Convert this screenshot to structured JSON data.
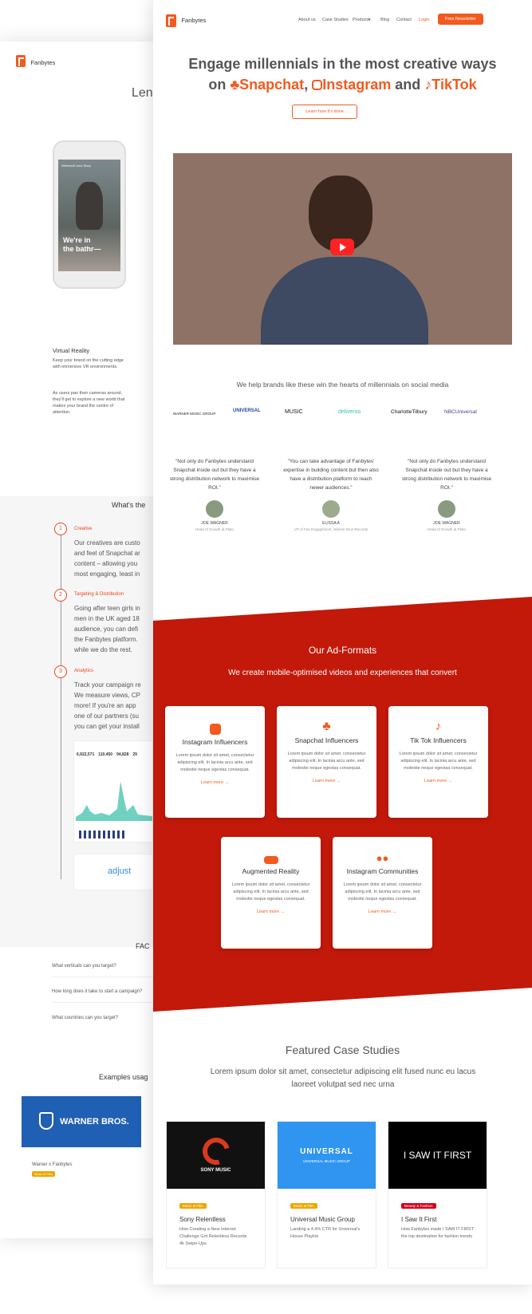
{
  "brand": "Fanbytes",
  "back": {
    "hero_partial": "Lens",
    "phone_overlay_title": "Werewolf Lens Story",
    "phone_caption_line1": "We're in",
    "phone_caption_line2": "the bathr—",
    "vr_title": "Virtual Reality",
    "vr_text1": "Keep your brand on the cutting edge with immersive VR environments.",
    "vr_text2": "As users pan their cameras around, they'll get to explore a new world that makes your brand the centre of attention.",
    "whats_partial": "What's the",
    "steps": [
      {
        "num": "1",
        "title": "Creative",
        "text": "Our creatives are custo and feel of Snapchat ar content – allowing you most engaging, least in"
      },
      {
        "num": "2",
        "title": "Targeting & Distribution",
        "text": "Going after teen girls in men in the UK aged 18 audience, you can defi the Fanbytes platform. while we do the rest."
      },
      {
        "num": "3",
        "title": "Analytics",
        "text": "Track your campaign re We measure views, CP more! If you're an app one of our partners (su you can get your install"
      }
    ],
    "stats": [
      "6,922,571",
      "110,450",
      "94,828",
      "29"
    ],
    "adjust": "adjust",
    "faq_partial": "FAC",
    "faqs": [
      "What verticals can you target?",
      "How long does it take to start a campaign?",
      "What countries can you target?"
    ],
    "examples_partial": "Examples usag",
    "wb_label": "WARNER BROS.",
    "wb_caption": "Warner x Fanbytes",
    "wb_tag": "Music & Film"
  },
  "nav": {
    "items": [
      "About us",
      "Case Studies",
      "Products",
      "Blog",
      "Contact"
    ],
    "login": "Login",
    "cta": "Free Newsletter"
  },
  "hero": {
    "line1": "Engage millennials in the most creative ways",
    "on": "on",
    "snapchat": "Snapchat",
    "comma": ",",
    "instagram": "Instagram",
    "and": "and",
    "tiktok": "TikTok",
    "button": "Learn how it's done"
  },
  "brands": {
    "heading": "We help brands like these win the hearts of millennials on social media",
    "logos": [
      "WARNER MUSIC GROUP",
      "UNIVERSAL",
      "MUSIC",
      "deliveroo",
      "CharlotteTilbury",
      "NBCUniversal"
    ]
  },
  "testimonials": [
    {
      "quote": "\"Not only do Fanbytes understand Snapchat inside out but they have a strong distribution network to maximise ROI.\"",
      "name": "JOE WAGNER",
      "role": "Head of Growth at Plato"
    },
    {
      "quote": "\"You can take advantage of Fanbytes' expertise in building content but then also have a distribution platform to reach newer audiences.\"",
      "name": "ELISSA A",
      "role": "VP of Fan Engagement, Warner Bros Records"
    },
    {
      "quote": "\"Not only do Fanbytes understand Snapchat inside out but they have a strong distribution network to maximise ROI.\"",
      "name": "JOE WAGNER",
      "role": "Head of Growth at Plato"
    }
  ],
  "ad_formats": {
    "title": "Our Ad-Formats",
    "subtitle": "We create mobile-optimised videos and experiences that convert",
    "cards": [
      {
        "title": "Instagram Influencers",
        "desc": "Lorem ipsum dolor sit amet, consectetur adipiscing elit. In lacinia arcu ante, sed molestie neque egestas consequat.",
        "link": "Learn more →",
        "icon": "instagram-icon"
      },
      {
        "title": "Snapchat Influencers",
        "desc": "Lorem ipsum dolor sit amet, consectetur adipiscing elit. In lacinia arcu ante, sed molestie neque egestas consequat.",
        "link": "Learn more →",
        "icon": "snapchat-icon"
      },
      {
        "title": "Tik Tok Influencers",
        "desc": "Lorem ipsum dolor sit amet, consectetur adipiscing elit. In lacinia arcu ante, sed molestie neque egestas consequat.",
        "link": "Learn more →",
        "icon": "tiktok-icon"
      },
      {
        "title": "Augmented Reality",
        "desc": "Lorem ipsum dolor sit amet, consectetur adipiscing elit. In lacinia arcu ante, sed molestie neque egestas consequat.",
        "link": "Learn more →",
        "icon": "ar-icon"
      },
      {
        "title": "Instagram Communities",
        "desc": "Lorem ipsum dolor sit amet, consectetur adipiscing elit. In lacinia arcu ante, sed molestie neque egestas consequat.",
        "link": "Learn more →",
        "icon": "community-icon"
      }
    ]
  },
  "case_studies": {
    "title": "Featured Case Studies",
    "subtitle": "Lorem ipsum dolor sit amet, consectetur adipiscing elit fused nunc eu lacus laoreet volutpat sed nec urna",
    "items": [
      {
        "image_label": "SONY MUSIC",
        "tag": "Music & Film",
        "tag_color": "#f0a500",
        "title": "Sony Relentless",
        "desc": "How Creating a New Internet Challenge Got Relentless Records 4k Swipe-Ups"
      },
      {
        "image_label": "UNIVERSAL",
        "image_sub": "UNIVERSAL MUSIC GROUP",
        "tag": "Music & Film",
        "tag_color": "#f0a500",
        "title": "Universal Music Group",
        "desc": "Landing a 4.4% CTR for Universal's House Playlist"
      },
      {
        "image_label": "I SAW IT FIRST",
        "tag": "Beauty & Fashion",
        "tag_color": "#d0021b",
        "title": "I Saw It First",
        "desc": "How Fanbytes made I SAW IT FIRST the top destination for fashion trends"
      }
    ]
  },
  "colors": {
    "accent": "#f25a1f",
    "red": "#c2190a"
  }
}
